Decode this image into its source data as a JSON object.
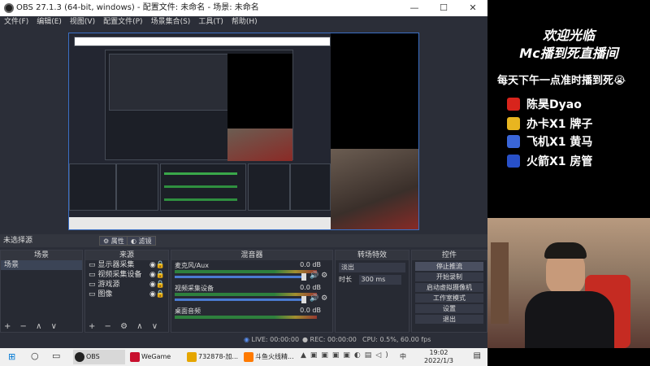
{
  "window": {
    "title": "OBS 27.1.3 (64-bit, windows) - 配置文件: 未命名 - 场景: 未命名",
    "controls": [
      "—",
      "☐",
      "✕"
    ]
  },
  "menu": [
    "文件(F)",
    "编辑(E)",
    "视图(V)",
    "配置文件(P)",
    "场景集合(S)",
    "工具(T)",
    "帮助(H)"
  ],
  "selection_bar": {
    "label": "未选择源",
    "properties": "属性",
    "filters": "滤镜"
  },
  "scenes": {
    "title": "场景",
    "items": [
      "场景"
    ],
    "footer": "+ − ∧ ∨"
  },
  "sources": {
    "title": "来源",
    "items": [
      "显示器采集",
      "视频采集设备",
      "游戏源",
      "图像"
    ],
    "footer": "+ − ⚙ ∧ ∨"
  },
  "mixer": {
    "title": "混音器",
    "items": [
      {
        "name": "麦克风/Aux",
        "value": "0.0 dB",
        "level": 0.7
      },
      {
        "name": "视频采集设备",
        "value": "0.0 dB",
        "level": 0.7
      },
      {
        "name": "桌面音频",
        "value": "0.0 dB",
        "level": 0.7
      }
    ]
  },
  "transitions": {
    "title": "转场特效",
    "type": "淡出",
    "duration_label": "时长",
    "duration_value": "300 ms"
  },
  "controls": {
    "title": "控件",
    "buttons": [
      "停止推流",
      "开始录制",
      "启动虚拟摄像机",
      "工作室模式",
      "设置",
      "退出"
    ]
  },
  "status": {
    "live": "LIVE: 00:00:00",
    "rec": "REC: 00:00:00",
    "cpu": "CPU: 0.5%, 60.00 fps"
  },
  "overlay": {
    "line1": "欢迎光临",
    "line2": "Mc播到死直播间",
    "schedule": "每天下午一点准时播到死😭",
    "items": [
      "陈昊Dyao",
      "办卡X1 牌子",
      "飞机X1 黄马",
      "火箭X1 房管"
    ],
    "item_colors": [
      "#d8241c",
      "#e8b520",
      "#3a66d8",
      "#2850c8"
    ]
  },
  "taskbar": {
    "apps": [
      "OBS 27.1.3...",
      "WeGame",
      "732878-加...",
      "斗鱼火线精..."
    ],
    "time": "19:02",
    "date": "2022/1/3"
  }
}
